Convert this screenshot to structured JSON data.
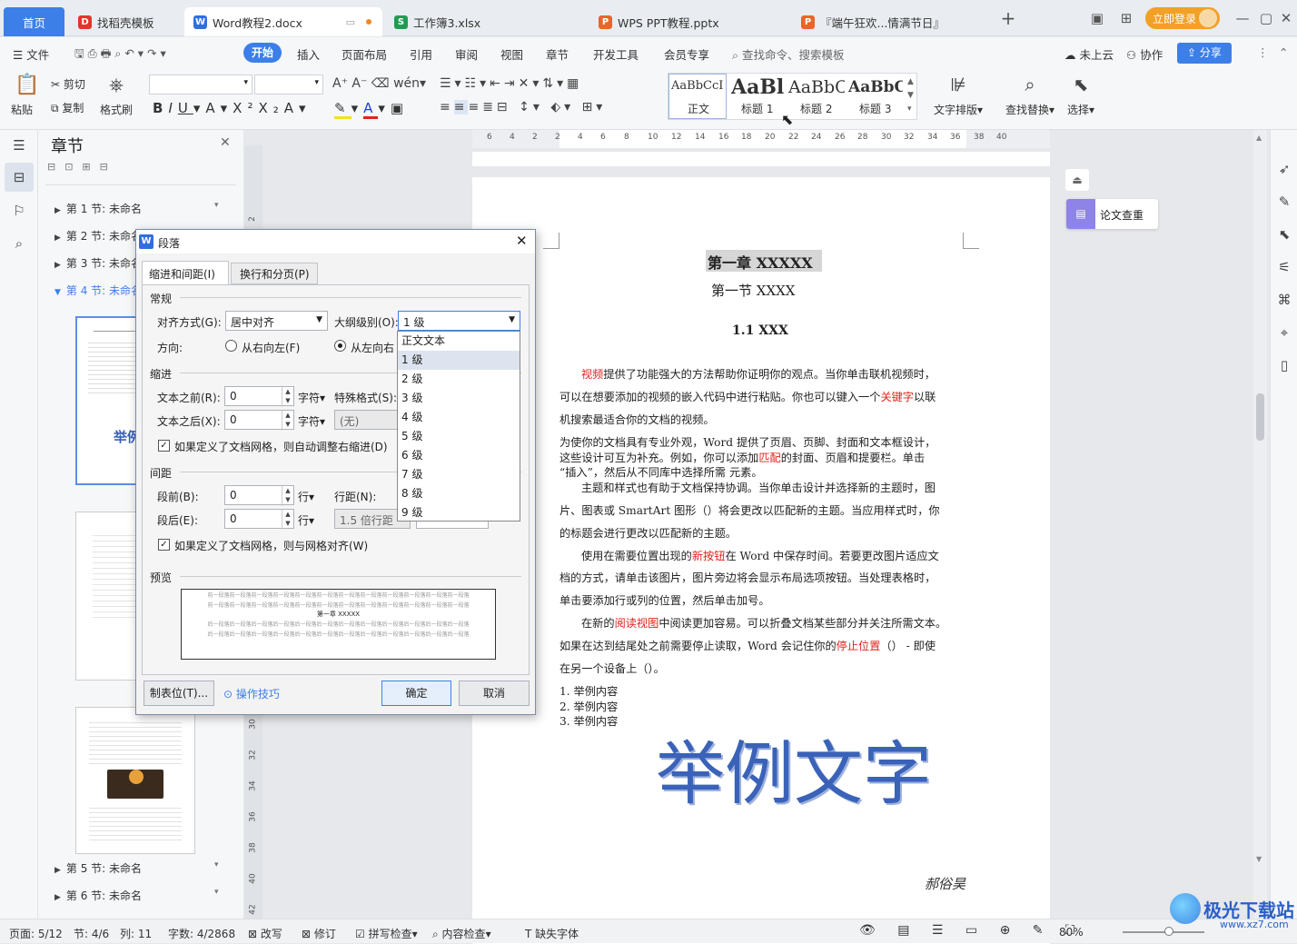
{
  "tabs": {
    "home": "首页",
    "items": [
      {
        "label": "找稻壳模板",
        "icon": "D"
      },
      {
        "label": "Word教程2.docx",
        "icon": "W"
      },
      {
        "label": "工作簿3.xlsx",
        "icon": "S"
      },
      {
        "label": "WPS PPT教程.pptx",
        "icon": "P"
      },
      {
        "label": "『端午狂欢...情满节日』",
        "icon": "P"
      }
    ],
    "login": "立即登录"
  },
  "menu": {
    "file": "文件",
    "items": [
      "开始",
      "插入",
      "页面布局",
      "引用",
      "审阅",
      "视图",
      "章节",
      "开发工具",
      "会员专享"
    ],
    "search": "查找命令、搜索模板",
    "cloud": "未上云",
    "collab": "协作",
    "share": "分享"
  },
  "ribbon": {
    "paste": "粘贴",
    "cut": "剪切",
    "copy": "复制",
    "format_painter": "格式刷",
    "styles": [
      {
        "sample": "AaBbCcI",
        "name": "正文"
      },
      {
        "sample": "AaBl",
        "name": "标题 1"
      },
      {
        "sample": "AaBbC",
        "name": "标题 2"
      },
      {
        "sample": "AaBbC",
        "name": "标题 3"
      }
    ],
    "text_layout": "文字排版",
    "find_replace": "查找替换",
    "select": "选择"
  },
  "nav": {
    "title": "章节",
    "sections": [
      "第 1 节: 未命名",
      "第 2 节: 未命名",
      "第 3 节: 未命名",
      "第 4 节: 未命名",
      "第 5 节: 未命名",
      "第 6 节: 未命名"
    ],
    "thumb_big_text": "举例"
  },
  "ruler": {
    "h": [
      "6",
      "4",
      "2",
      "2",
      "4",
      "6",
      "8",
      "10",
      "12",
      "14",
      "16",
      "18",
      "20",
      "22",
      "24",
      "26",
      "28",
      "30",
      "32",
      "34",
      "36",
      "38",
      "40"
    ],
    "v": [
      "2",
      "30",
      "32",
      "34",
      "36",
      "38",
      "40",
      "42"
    ]
  },
  "document": {
    "chapter": "第一章 XXXXX",
    "section": "第一节 XXXX",
    "heading": "1.1 XXX",
    "p1": [
      "视频",
      "提供了功能强大的方法帮助你证明你的观点。当你单击联机视频时，"
    ],
    "p1b": [
      "可以在想要添加的视频的嵌入代码中进行粘贴。你也可以键入一个",
      "关键字",
      "以联"
    ],
    "p1c": "机搜索最适合你的文档的视频。",
    "p2a": "为使你的文档具有专业外观，Word 提供了页眉、页脚、封面和文本框设计，",
    "p2b": [
      "这些设计可互为补充。例如，你可以添加",
      "匹配",
      "的封面、页眉和提要栏。单击"
    ],
    "p2c": "“插入”，然后从不同库中选择所需 元素。",
    "p3a": "主题和样式也有助于文档保持协调。当你单击设计并选择新的主题时，图",
    "p3b": "片、图表或 SmartArt 图形（）将会更改以匹配新的主题。当应用样式时，你",
    "p3c": "的标题会进行更改以匹配新的主题。",
    "p4a": [
      "使用在需要位置出现的",
      "新按钮",
      "在 Word 中保存时间。若要更改图片适应文"
    ],
    "p4b": "档的方式，请单击该图片，图片旁边将会显示布局选项按钮。当处理表格时，",
    "p4c": "单击要添加行或列的位置，然后单击加号。",
    "p5a": [
      "在新的",
      "阅读视图",
      "中阅读更加容易。可以折叠文档某些部分并关注所需文本。"
    ],
    "p5b": [
      "如果在达到结尾处之前需要停止读取，Word 会记住你的",
      "停止位置",
      "（） - 即使"
    ],
    "p5c": "在另一个设备上（）。",
    "list": [
      "1. 举例内容",
      "2. 举例内容",
      "3. 举例内容"
    ],
    "art": "举例文字",
    "signature": "郝俗昊"
  },
  "right": {
    "lwcc": "论文查重"
  },
  "dialog": {
    "title": "段落",
    "tab1": "缩进和间距(I)",
    "tab2": "换行和分页(P)",
    "general": "常规",
    "align_label": "对齐方式(G):",
    "align_value": "居中对齐",
    "outline_label": "大纲级别(O):",
    "outline_value": "1 级",
    "direction_label": "方向:",
    "rtl": "从右向左(F)",
    "ltr": "从左向右",
    "indent": "缩进",
    "before_text": "文本之前(R):",
    "before_val": "0",
    "after_text": "文本之后(X):",
    "after_val": "0",
    "unit_char": "字符▾",
    "special_label": "特殊格式(S):",
    "special_value": "(无)",
    "auto_adjust": "如果定义了文档网格，则自动调整右缩进(D)",
    "spacing": "间距",
    "sp_before": "段前(B):",
    "sp_before_val": "0",
    "sp_after": "段后(E):",
    "sp_after_val": "0",
    "unit_line": "行▾",
    "line_spacing": "行距(N):",
    "line_spacing_val": "1.5 倍行距",
    "grid_align": "如果定义了文档网格，则与网格对齐(W)",
    "preview": "预览",
    "preview_text": "前一段落前一段落前一段落前一段落前一段落前一段落前一段落前一段落前一段落前一段落前一段落前一段落",
    "preview_mid": "第一章 XXXXX",
    "preview_after": "后一段落后一段落后一段落后一段落后一段落后一段落后一段落后一段落后一段落后一段落后一段落后一段落",
    "tabs_btn": "制表位(T)...",
    "tips": "操作技巧",
    "ok": "确定",
    "cancel": "取消",
    "outline_options": [
      "正文文本",
      "1 级",
      "2 级",
      "3 级",
      "4 级",
      "5 级",
      "6 级",
      "7 级",
      "8 级",
      "9 级"
    ]
  },
  "status": {
    "page": "页面: 5/12",
    "section": "节: 4/6",
    "col": "列: 11",
    "words": "字数: 4/2868",
    "rewrite": "改写",
    "revise": "修订",
    "spell": "拼写检查",
    "content_check": "内容检查",
    "missing_font": "缺失字体",
    "zoom": "80%"
  },
  "watermark": {
    "text": "极光下载站",
    "url": "www.xz7.com"
  },
  "colors": {
    "accent": "#3d7fe9",
    "red_text": "#e0241b",
    "art_blue": "#3a62b8"
  }
}
